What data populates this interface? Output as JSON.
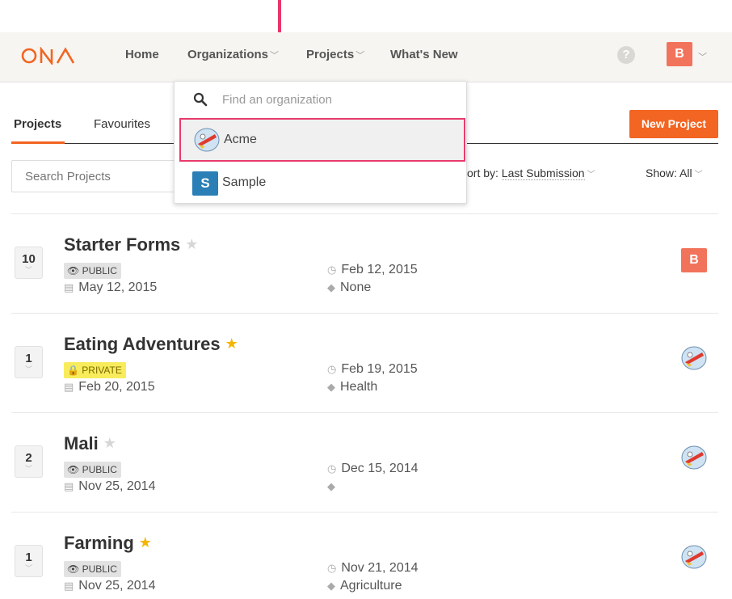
{
  "nav": {
    "home": "Home",
    "organizations": "Organizations",
    "projects": "Projects",
    "whats_new": "What's New",
    "help": "?",
    "user_initial": "B"
  },
  "tabs": {
    "projects": "Projects",
    "favourites": "Favourites"
  },
  "new_project": "New Project",
  "search_placeholder": "Search Projects",
  "sort": {
    "prefix": "ort by: ",
    "value": "Last Submission"
  },
  "show": {
    "prefix": "Show: ",
    "value": "All"
  },
  "dropdown": {
    "placeholder": "Find an organization",
    "items": [
      {
        "label": "Acme"
      },
      {
        "label": "Sample",
        "initial": "S"
      }
    ]
  },
  "projects": [
    {
      "count": "10",
      "title": "Starter Forms",
      "favourite": false,
      "visibility": "PUBLIC",
      "created": "May 12, 2015",
      "last": "Feb 12, 2015",
      "tags": "None",
      "owner_initial": "B"
    },
    {
      "count": "1",
      "title": "Eating Adventures",
      "favourite": true,
      "visibility": "PRIVATE",
      "created": "Feb 20, 2015",
      "last": "Feb 19, 2015",
      "tags": "Health"
    },
    {
      "count": "2",
      "title": "Mali",
      "favourite": false,
      "visibility": "PUBLIC",
      "created": "Nov 25, 2014",
      "last": "Dec 15, 2014",
      "tags": ""
    },
    {
      "count": "1",
      "title": "Farming",
      "favourite": true,
      "visibility": "PUBLIC",
      "created": "Nov 25, 2014",
      "last": "Nov 21, 2014",
      "tags": "Agriculture"
    }
  ],
  "colors": {
    "accent": "#f26522",
    "highlight_border": "#e83a6b",
    "annotation": "#e8366b"
  }
}
